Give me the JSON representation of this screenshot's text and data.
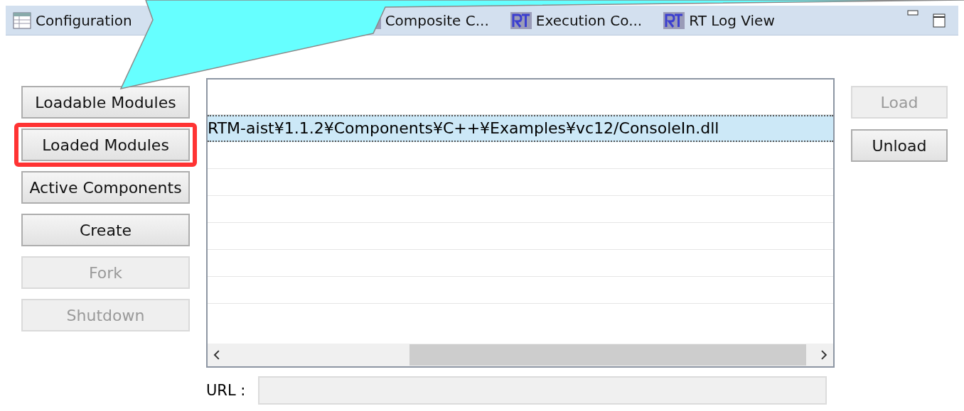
{
  "tabs": [
    {
      "label": "Configuration",
      "kind": "table",
      "selected": false
    },
    {
      "label": "Composite C...",
      "kind": "rt",
      "selected": false
    },
    {
      "label": "Execution Co...",
      "kind": "rt",
      "selected": false
    },
    {
      "label": "RT Log View",
      "kind": "rt",
      "selected": false
    }
  ],
  "side_buttons": [
    {
      "label": "Loadable Modules",
      "disabled": false,
      "highlighted": false
    },
    {
      "label": "Loaded Modules",
      "disabled": false,
      "highlighted": true
    },
    {
      "label": "Active Components",
      "disabled": false,
      "highlighted": false
    },
    {
      "label": "Create",
      "disabled": false,
      "highlighted": false
    },
    {
      "label": "Fork",
      "disabled": true,
      "highlighted": false
    },
    {
      "label": "Shutdown",
      "disabled": true,
      "highlighted": false
    }
  ],
  "list": {
    "rows": [
      {
        "text": "",
        "selected": false
      },
      {
        "text": "RTM-aist¥1.1.2¥Components¥C++¥Examples¥vc12/ConsoleIn.dll",
        "selected": true
      },
      {
        "text": "",
        "selected": false
      },
      {
        "text": "",
        "selected": false
      },
      {
        "text": "",
        "selected": false
      },
      {
        "text": "",
        "selected": false
      },
      {
        "text": "",
        "selected": false
      },
      {
        "text": "",
        "selected": false
      }
    ]
  },
  "action_buttons": [
    {
      "label": "Load",
      "disabled": true
    },
    {
      "label": "Unload",
      "disabled": false
    }
  ],
  "url": {
    "label": "URL :"
  }
}
